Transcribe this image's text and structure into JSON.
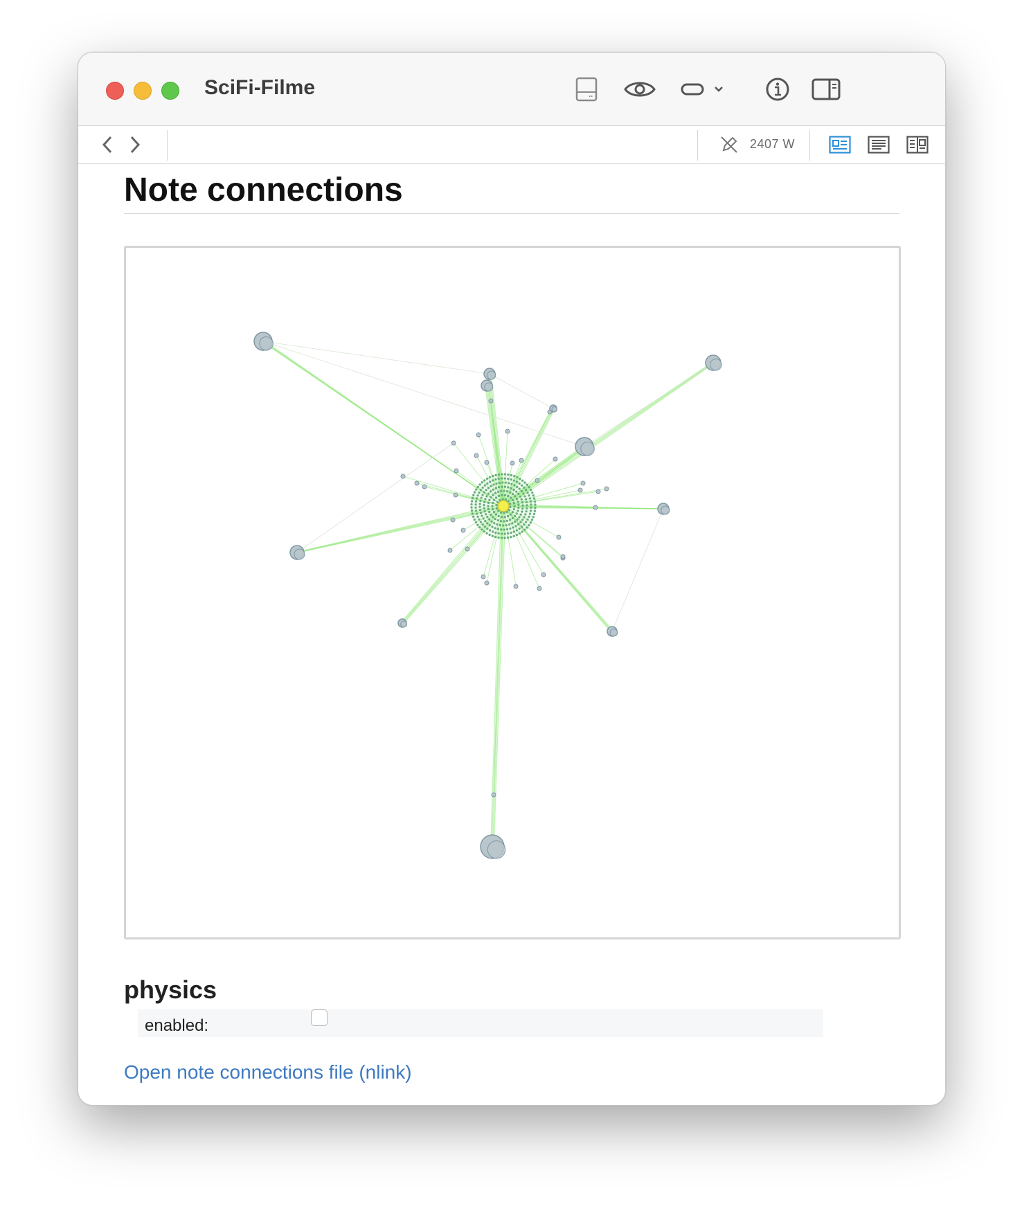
{
  "window": {
    "title": "SciFi-Filme"
  },
  "toolbar": {
    "word_count": "2407 W"
  },
  "main": {
    "heading": "Note connections",
    "physics_heading": "physics",
    "enabled_label": "enabled:",
    "enabled_checked": false,
    "open_link_label": "Open note connections file (nlink)"
  },
  "colors": {
    "edge": "#8fe878",
    "node_fill": "#b9c6cc",
    "node_stroke": "#7f97a3",
    "center_node": "#f3f04e",
    "link": "#3d7ac2",
    "accent_blue": "#2f8fd8"
  },
  "icons": {
    "back": "chevron-left-icon",
    "forward": "chevron-right-icon",
    "editor_toggle": "editor-icon",
    "preview": "eye-icon",
    "mode": "toggle-icon",
    "info": "info-icon",
    "sidebar": "sidebar-icon",
    "draft": "pencil-off-icon",
    "view_preview": "preview-layout-icon",
    "view_text": "text-layout-icon",
    "view_split": "split-layout-icon"
  }
}
